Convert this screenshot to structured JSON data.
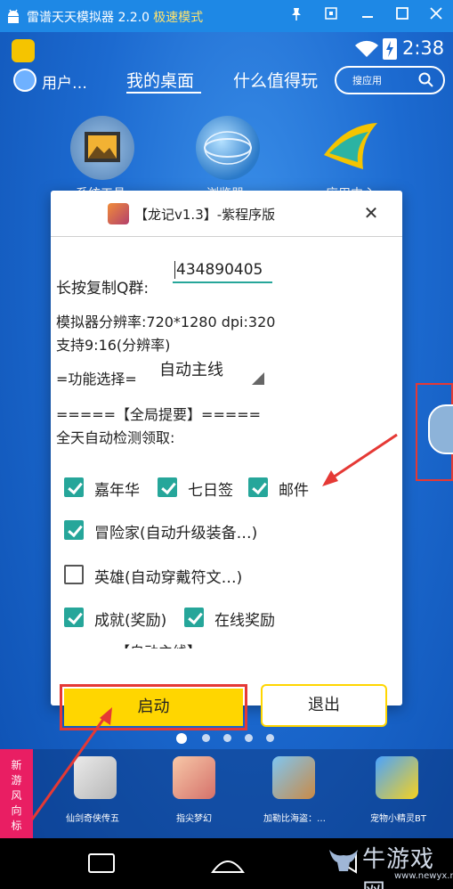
{
  "window": {
    "title": "雷谱天天模拟器 2.2.0",
    "mode": "极速模式",
    "buttons": [
      "pin-icon",
      "restore-icon",
      "minimize-icon",
      "maximize-icon",
      "close-icon"
    ]
  },
  "statusbar": {
    "time": "2:38"
  },
  "launcher": {
    "user": "用户…",
    "tabs": [
      "我的桌面",
      "什么值得玩"
    ],
    "search_placeholder": "搜应用",
    "icons": [
      "系统工具",
      "浏览器",
      "应用中心"
    ]
  },
  "dialog": {
    "title": "【龙记v1.3】-紫程序版",
    "qq_label": "长按复制Q群:",
    "qq_value": "434890405",
    "resolution": "模拟器分辨率:720*1280 dpi:320",
    "support": "支持9:16(分辨率)",
    "func_label": "=功能选择=",
    "func_value": "自动主线",
    "section_global": "=====【全局提要】=====",
    "auto_detect": "全天自动检测领取:",
    "checks": [
      {
        "label": "嘉年华",
        "checked": true
      },
      {
        "label": "七日签",
        "checked": true
      },
      {
        "label": "邮件",
        "checked": true
      },
      {
        "label": "冒险家(自动升级装备…)",
        "checked": true
      },
      {
        "label": "英雄(自动穿戴符文…)",
        "checked": false
      },
      {
        "label": "成就(奖励)",
        "checked": true
      },
      {
        "label": "在线奖励",
        "checked": true
      }
    ],
    "section_main": "=====【自动主线】=====",
    "start_button": "启动",
    "exit_button": "退出"
  },
  "dock": {
    "tag": "新游风向标",
    "apps": [
      "仙剑奇侠传五",
      "指尖梦幻",
      "加勒比海盗：…",
      "宠物小精灵BT"
    ]
  },
  "watermark": {
    "text": "牛游戏网",
    "url": "www.newyx.net"
  },
  "colors": {
    "titlebar": "#1e88e5",
    "accent": "#26a69a",
    "start": "#ffd600",
    "highlight": "#e53935"
  }
}
